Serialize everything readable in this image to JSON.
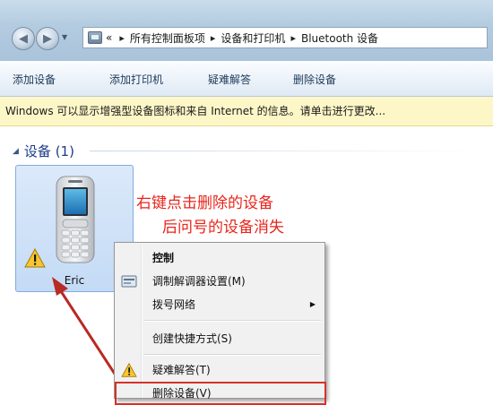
{
  "address": {
    "prefix": "«",
    "crumbs": [
      "所有控制面板项",
      "设备和打印机",
      "Bluetooth 设备"
    ],
    "separator": "▸"
  },
  "toolbar": {
    "add_device": "添加设备",
    "add_printer": "添加打印机",
    "troubleshoot": "疑难解答",
    "remove_device": "删除设备"
  },
  "infobar": {
    "text": "Windows 可以显示增强型设备图标和来自 Internet 的信息。请单击进行更改..."
  },
  "group": {
    "label": "设备 (1)"
  },
  "device": {
    "name": "Eric",
    "icon": "mobile-phone-icon",
    "status_icon": "warning-icon"
  },
  "annotation": {
    "line1": "右键点击删除的设备",
    "line2": "后问号的设备消失"
  },
  "context_menu": {
    "items": [
      {
        "label": "控制",
        "bold": true
      },
      {
        "label": "调制解调器设置(M)",
        "icon": "modem-settings-icon"
      },
      {
        "label": "拨号网络",
        "submenu": true
      },
      {
        "label": "创建快捷方式(S)"
      },
      {
        "label": "疑难解答(T)",
        "icon": "warning-icon"
      },
      {
        "label": "删除设备(V)"
      }
    ]
  },
  "colors": {
    "annotation": "#e8251c",
    "highlight": "#d6322b",
    "group_header": "#1e3b8a",
    "infobar": "#fdf7c8",
    "tile": "#c4dbf5"
  }
}
